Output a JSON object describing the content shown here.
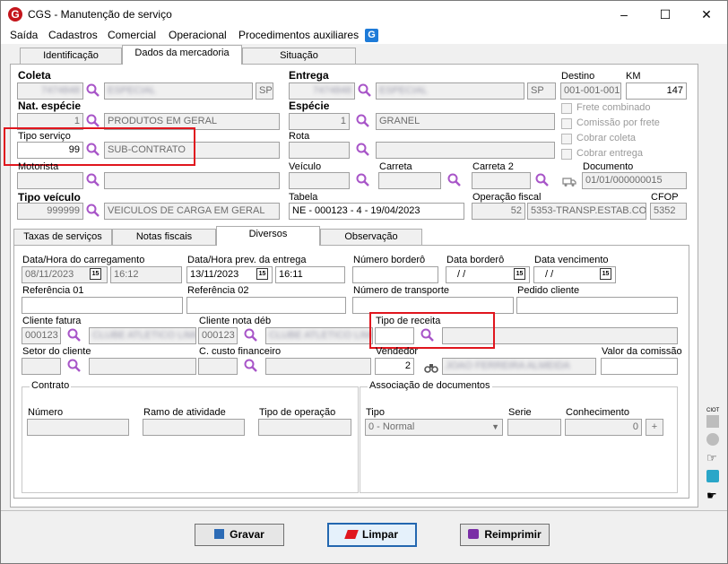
{
  "window": {
    "title": "CGS - Manutenção de serviço",
    "minimize": "–",
    "maximize": "☐",
    "close": "✕"
  },
  "menu": [
    "Saída",
    "Cadastros",
    "Comercial",
    "Operacional",
    "Procedimentos auxiliares"
  ],
  "tabs_top": [
    "Identificação",
    "Dados da mercadoria",
    "Situação"
  ],
  "top": {
    "coleta_label": "Coleta",
    "coleta_code": "7474848",
    "coleta_name": "ESPECIAL",
    "coleta_uf": "SP",
    "entrega_label": "Entrega",
    "entrega_code": "7474848",
    "entrega_name": "ESPECIAL",
    "entrega_uf": "SP",
    "destino_label": "Destino",
    "destino_value": "001-001-001",
    "km_label": "KM",
    "km_value": "147",
    "nat_label": "Nat. espécie",
    "nat_code": "1",
    "nat_name": "PRODUTOS EM GERAL",
    "especie_label": "Espécie",
    "especie_code": "1",
    "especie_name": "GRANEL",
    "frete_combinado": "Frete combinado",
    "comissao_frete": "Comissão por frete",
    "cobrar_coleta": "Cobrar coleta",
    "cobrar_entrega": "Cobrar entrega",
    "tipo_servico_label": "Tipo serviço",
    "tipo_servico_code": "99",
    "tipo_servico_name": "SUB-CONTRATO",
    "rota_label": "Rota",
    "motorista_label": "Motorista",
    "veiculo_label": "Veículo",
    "carreta_label": "Carreta",
    "carreta2_label": "Carreta 2",
    "documento_label": "Documento",
    "documento_value": "01/01/000000015",
    "tipo_veiculo_label": "Tipo veículo",
    "tipo_veiculo_code": "999999",
    "tipo_veiculo_name": "VEICULOS DE CARGA EM GERAL",
    "tabela_label": "Tabela",
    "tabela_value": "NE - 000123 - 4 - 19/04/2023",
    "operacao_label": "Operação fiscal",
    "operacao_code": "52",
    "operacao_name": "5353-TRANSP.ESTAB.CO",
    "cfop_label": "CFOP",
    "cfop_value": "5352"
  },
  "tabs_bottom": [
    "Taxas de serviços",
    "Notas fiscais",
    "Diversos",
    "Observação"
  ],
  "div": {
    "carreg_label": "Data/Hora do carregamento",
    "carreg_date": "08/11/2023",
    "carreg_time": "16:12",
    "prev_label": "Data/Hora prev. da entrega",
    "prev_date": "13/11/2023",
    "prev_time": "16:11",
    "num_bordero_label": "Número borderô",
    "data_bordero_label": "Data borderô",
    "data_bordero_value": "/ /",
    "data_venc_label": "Data vencimento",
    "data_venc_value": "/ /",
    "ref1_label": "Referência 01",
    "ref2_label": "Referência 02",
    "num_transp_label": "Número de transporte",
    "pedido_label": "Pedido cliente",
    "cli_fatura_label": "Cliente fatura",
    "cli_fatura_code": "000123",
    "cli_fatura_name": "CLUBE ATLETICO LIMIAR",
    "cli_nota_label": "Cliente nota déb",
    "cli_nota_code": "000123",
    "cli_nota_name": "CLUBE ATLETICO LIMIAR",
    "tipo_receita_label": "Tipo de receita",
    "setor_label": "Setor do cliente",
    "custo_label": "C. custo financeiro",
    "vendedor_label": "Vendedor",
    "vendedor_code": "2",
    "vendedor_name": "JOAO FERREIRA ALMEIDA",
    "comissao_label": "Valor da comissão",
    "contrato_label": "Contrato",
    "numero_label": "Número",
    "ramo_label": "Ramo de atividade",
    "tipo_op_label": "Tipo de operação",
    "assoc_label": "Associação de documentos",
    "tipo_label": "Tipo",
    "tipo_value": "0 - Normal",
    "serie_label": "Serie",
    "conhec_label": "Conhecimento",
    "conhec_value": "0"
  },
  "buttons": {
    "gravar": "Gravar",
    "limpar": "Limpar",
    "reimprimir": "Reimprimir"
  },
  "side": {
    "label": "CIOT"
  }
}
